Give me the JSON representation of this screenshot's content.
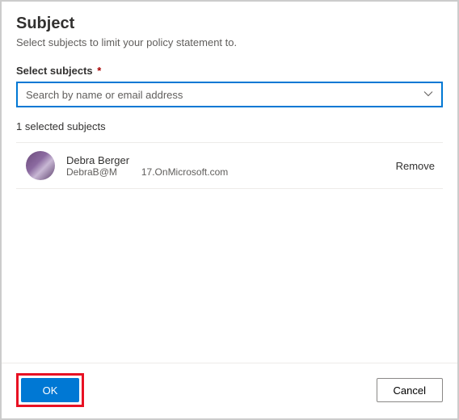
{
  "header": {
    "title": "Subject",
    "subtitle": "Select subjects to limit your policy statement to."
  },
  "field": {
    "label": "Select subjects",
    "required_marker": "*",
    "placeholder": "Search by name or email address"
  },
  "selected_label": "1 selected subjects",
  "subjects": [
    {
      "name": "Debra Berger",
      "email_part1": "DebraB@M",
      "email_part2": "17.OnMicrosoft.com",
      "remove_label": "Remove"
    }
  ],
  "footer": {
    "ok_label": "OK",
    "cancel_label": "Cancel"
  },
  "colors": {
    "primary": "#0078d4",
    "highlight": "#e81123"
  }
}
